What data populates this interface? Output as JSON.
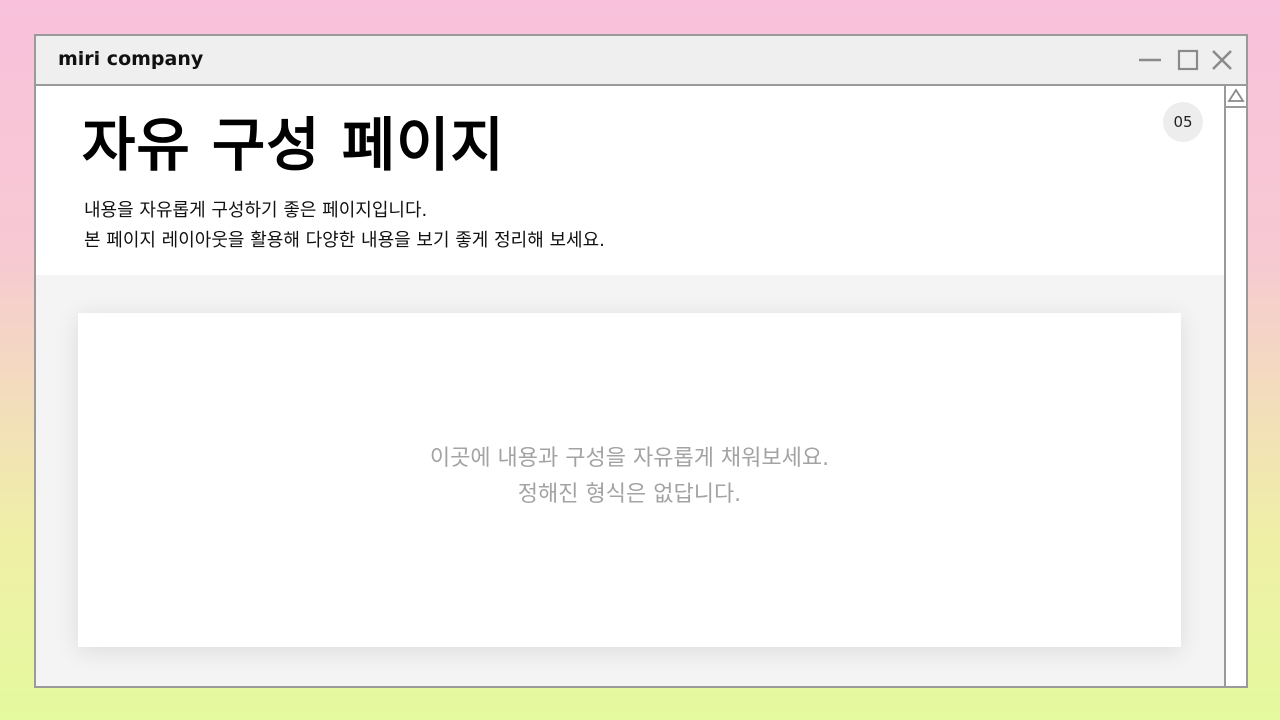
{
  "window": {
    "title": "miri company"
  },
  "header": {
    "title": "자유 구성 페이지",
    "description_line1": "내용을 자유롭게 구성하기 좋은 페이지입니다.",
    "description_line2": "본 페이지 레이아웃을 활용해 다양한 내용을 보기 좋게 정리해 보세요.",
    "page_number": "05"
  },
  "card": {
    "placeholder_line1": "이곳에 내용과 구성을 자유롭게 채워보세요.",
    "placeholder_line2": "정해진 형식은 없답니다."
  },
  "icons": {
    "minimize": "minimize-icon",
    "maximize": "maximize-icon",
    "close": "close-icon",
    "scroll_up": "scroll-up-arrow-icon"
  },
  "colors": {
    "window_border": "#9a9a9a",
    "titlebar_bg": "#efefef",
    "panel_bg": "#f4f4f4",
    "placeholder_text": "#a3a3a3",
    "background_top": "#f9c1db",
    "background_bottom": "#e5f99e"
  }
}
